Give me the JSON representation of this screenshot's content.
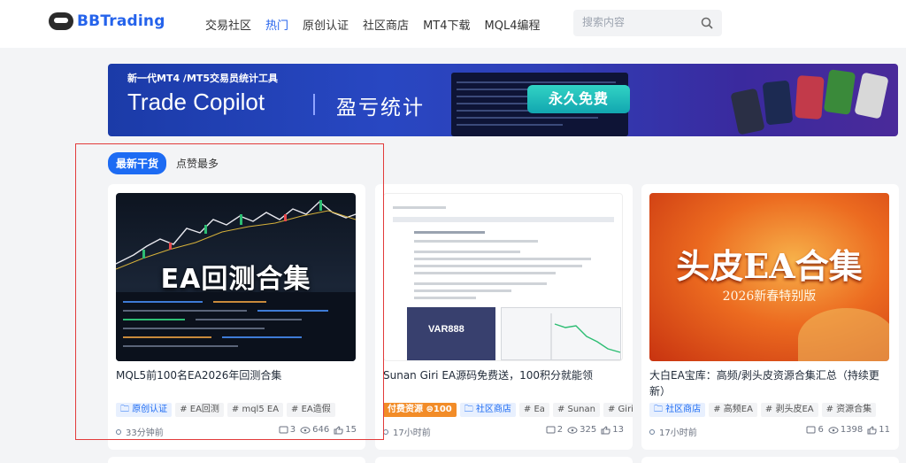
{
  "header": {
    "logo_text": "BBTrading",
    "nav": [
      "交易社区",
      "热门",
      "原创认证",
      "社区商店",
      "MT4下载",
      "MQL4编程"
    ],
    "active_nav": "热门",
    "search_placeholder": "搜索内容"
  },
  "banner": {
    "subtitle": "新一代MT4 /MT5交易员统计工具",
    "title": "Trade Copilot",
    "cn_title": "盈亏统计",
    "badge": "永久免费"
  },
  "tabs": {
    "latest": "最新干货",
    "most_liked": "点赞最多"
  },
  "cards": [
    {
      "image_text": "EA回测合集",
      "title": "MQL5前100名EA2026年回测合集",
      "tags": [
        {
          "label": "原创认证",
          "kind": "blue"
        },
        {
          "label": "# EA回测",
          "kind": "gray"
        },
        {
          "label": "# mql5 EA",
          "kind": "gray"
        },
        {
          "label": "# EA造假",
          "kind": "gray"
        }
      ],
      "time": "33分钟前",
      "comments": "3",
      "views": "646",
      "likes": "15"
    },
    {
      "image_text": "VAR888",
      "title": "Sunan Giri EA源码免费送，100积分就能领",
      "tags": [
        {
          "label": "付费资源 ⊜100",
          "kind": "orange"
        },
        {
          "label": "社区商店",
          "kind": "blue"
        },
        {
          "label": "# Ea",
          "kind": "gray"
        },
        {
          "label": "# Sunan",
          "kind": "gray"
        },
        {
          "label": "# Giri",
          "kind": "gray"
        }
      ],
      "time": "17小时前",
      "comments": "2",
      "views": "325",
      "likes": "13"
    },
    {
      "image_text": "头皮EA合集",
      "image_subtext": "2026新春特别版",
      "title": "大白EA宝库：高频/剥头皮资源合集汇总（持续更新）",
      "tags": [
        {
          "label": "社区商店",
          "kind": "blue"
        },
        {
          "label": "# 高频EA",
          "kind": "gray"
        },
        {
          "label": "# 剥头皮EA",
          "kind": "gray"
        },
        {
          "label": "# 资源合集",
          "kind": "gray"
        }
      ],
      "time": "17小时前",
      "comments": "6",
      "views": "1398",
      "likes": "11"
    }
  ],
  "colors": {
    "accent": "#1d6bf3",
    "highlight": "#e23b3b",
    "paid": "#f28c28"
  }
}
